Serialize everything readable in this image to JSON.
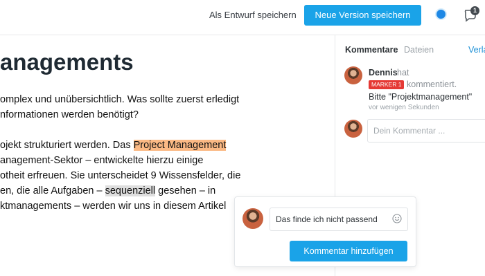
{
  "toolbar": {
    "draft_label": "Als Entwurf speichern",
    "new_version_label": "Neue Version speichern",
    "notification_count": "1",
    "accent_color": "#1aa3e8"
  },
  "document": {
    "title": "anagements",
    "paragraph1": {
      "line1": "omplex und unübersichtlich. Was sollte zuerst erledigt",
      "line2": "nformationen werden benötigt?"
    },
    "paragraph2": {
      "line1_pre": "ojekt strukturiert werden. Das ",
      "line1_highlight": "Project Management",
      "line2": "anagement-Sektor – entwickelte hierzu einige",
      "line3": "otheit erfreuen. Sie unterscheidet 9 Wissensfelder, die",
      "line4_pre": "en, die alle Aufgaben – ",
      "line4_highlight": "sequenziell",
      "line4_post": " gesehen – in",
      "line5": "ktmanagements – werden wir uns in diesem Artikel"
    }
  },
  "sidebar": {
    "tabs": [
      "Kommentare",
      "Dateien",
      "Verla"
    ],
    "comment": {
      "author": "Dennis",
      "hat": "hat",
      "marker": "MARKER 1",
      "action": "kommentiert.",
      "text": "Bitte \"Projektmanagement\"",
      "time": "vor wenigen Sekunden"
    },
    "reply_placeholder": "Dein Kommentar ..."
  },
  "popup": {
    "input_value": "Das finde ich nicht passend",
    "button_label": "Kommentar hinzufügen"
  },
  "icons": {
    "status": "status-dot-icon",
    "notifications": "comment-bubble-icon",
    "emoji": "smiley-icon"
  }
}
